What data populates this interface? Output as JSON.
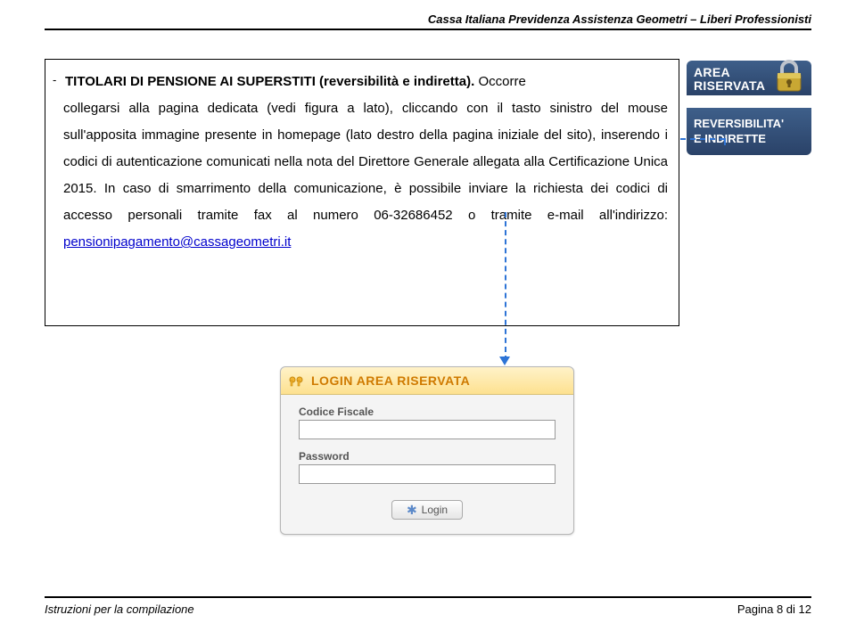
{
  "header": {
    "org": "Cassa Italiana Previdenza Assistenza Geometri – Liberi Professionisti"
  },
  "content": {
    "title": "TITOLARI DI PENSIONE AI SUPERSTITI (reversibilità e indiretta).",
    "lead_word": "Occorre",
    "body": "collegarsi alla pagina dedicata (vedi figura a lato), cliccando con il tasto sinistro del mouse sull'apposita immagine presente in homepage (lato destro della pagina iniziale del sito), inserendo i codici di autenticazione comunicati nella nota del Direttore Generale allegata alla Certificazione Unica 2015. In caso di smarrimento della comunicazione, è possibile inviare la richiesta dei codici di accesso personali tramite fax al numero 06-32686452 o tramite e-mail all'indirizzo: ",
    "email": "pensionipagamento@cassageometri.it"
  },
  "area_widget": {
    "top_line1": "AREA",
    "top_line2": "RISERVATA",
    "bottom_line1": "REVERSIBILITA'",
    "bottom_line2": "E INDIRETTE"
  },
  "login": {
    "header": "LOGIN AREA RISERVATA",
    "field1_label": "Codice Fiscale",
    "field1_value": "",
    "field2_label": "Password",
    "field2_value": "",
    "button": "Login"
  },
  "footer": {
    "left": "Istruzioni per la compilazione",
    "right_prefix": "Pagina ",
    "right_page": "8",
    "right_of": " di ",
    "right_total": "12"
  }
}
